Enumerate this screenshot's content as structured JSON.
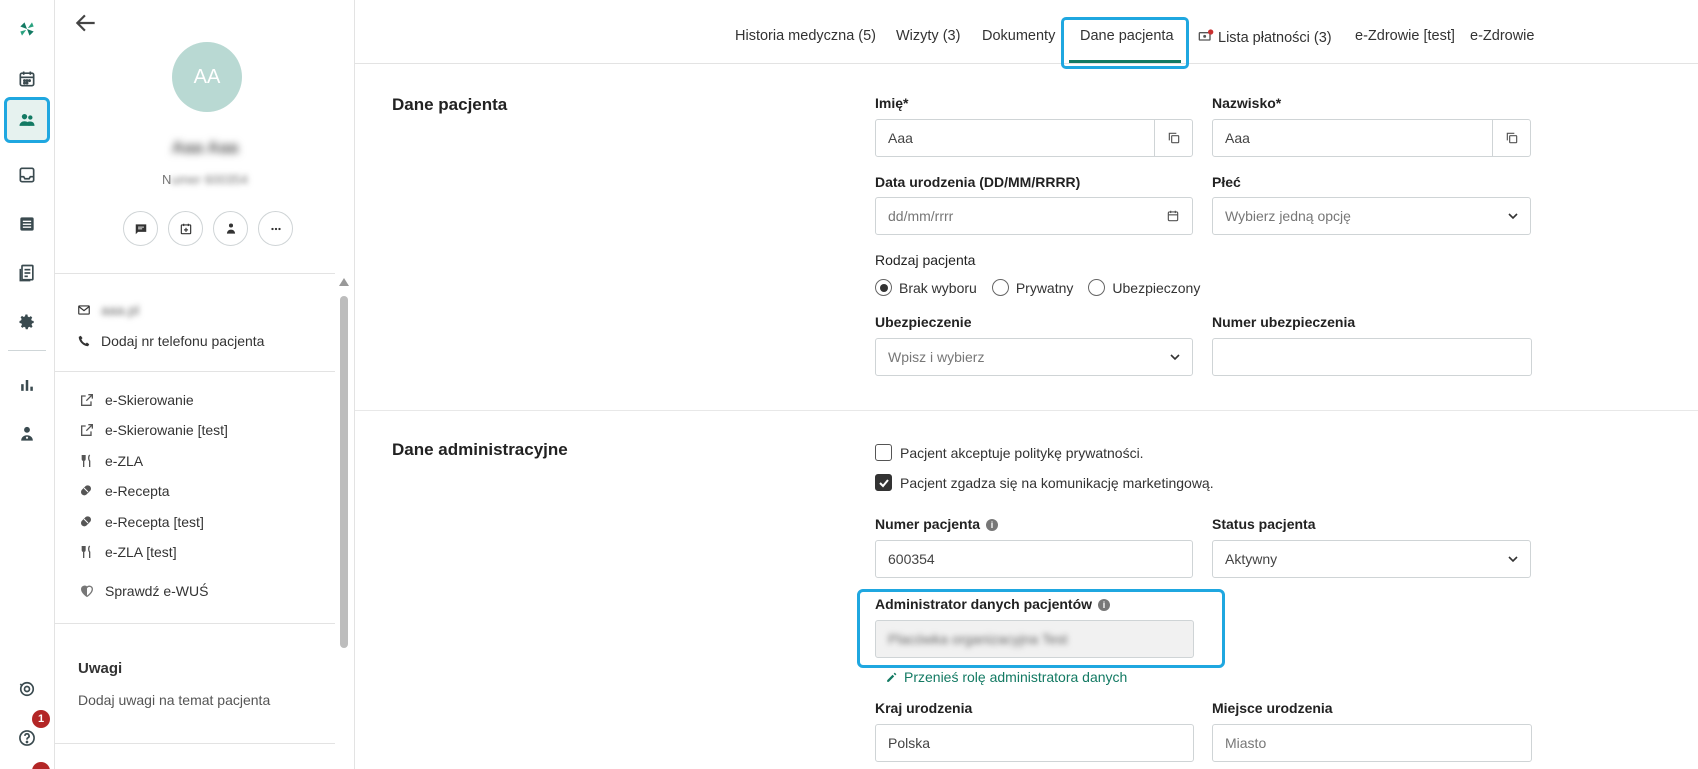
{
  "rail": {
    "badge_help": "1"
  },
  "patient": {
    "initials": "AA",
    "name": "Aaa Aaa",
    "number_prefix": "N",
    "number_rest": "umer 600354",
    "email": "aaa.pl",
    "add_phone": "Dodaj nr telefonu pacjenta",
    "links": [
      {
        "label": "e-Skierowanie",
        "icon": "external-link-icon"
      },
      {
        "label": "e-Skierowanie [test]",
        "icon": "external-link-icon"
      },
      {
        "label": "e-ZLA",
        "icon": "fork-knife-icon"
      },
      {
        "label": "e-Recepta",
        "icon": "pill-icon"
      },
      {
        "label": "e-Recepta [test]",
        "icon": "pill-icon"
      },
      {
        "label": "e-ZLA [test]",
        "icon": "fork-knife-icon"
      }
    ],
    "ewus": "Sprawdź e-WUŚ",
    "notes_title": "Uwagi",
    "notes_add": "Dodaj uwagi na temat pacjenta"
  },
  "tabs": [
    {
      "label": "Historia medyczna (5)"
    },
    {
      "label": "Wizyty (3)"
    },
    {
      "label": "Dokumenty"
    },
    {
      "label": "Dane pacjenta",
      "active": true
    },
    {
      "label": "Lista płatności (3)"
    },
    {
      "label": "e-Zdrowie [test]"
    },
    {
      "label": "e-Zdrowie"
    }
  ],
  "patient_data": {
    "section_title": "Dane pacjenta",
    "first_name_label": "Imię*",
    "first_name_value": "Aaa",
    "last_name_label": "Nazwisko*",
    "last_name_value": "Aaa",
    "dob_label": "Data urodzenia (DD/MM/RRRR)",
    "dob_placeholder": "dd/mm/rrrr",
    "sex_label": "Płeć",
    "sex_placeholder": "Wybierz jedną opcję",
    "type_label": "Rodzaj pacjenta",
    "type_options": [
      "Brak wyboru",
      "Prywatny",
      "Ubezpieczony"
    ],
    "type_selected": "Brak wyboru",
    "insurance_label": "Ubezpieczenie",
    "insurance_placeholder": "Wpisz i wybierz",
    "insurance_number_label": "Numer ubezpieczenia",
    "insurance_number_value": ""
  },
  "admin_data": {
    "section_title": "Dane administracyjne",
    "privacy_consent": "Pacjent akceptuje politykę prywatności.",
    "privacy_checked": false,
    "marketing_consent": "Pacjent zgadza się na komunikację marketingową.",
    "marketing_checked": true,
    "patient_number_label": "Numer pacjenta",
    "patient_number_value": "600354",
    "status_label": "Status pacjenta",
    "status_value": "Aktywny",
    "data_admin_label": "Administrator danych pacjentów",
    "data_admin_value": "Placówka organizacyjna Test",
    "move_role": "Przenieś rolę administratora danych",
    "birth_country_label": "Kraj urodzenia",
    "birth_country_value": "Polska",
    "birth_place_label": "Miejsce urodzenia",
    "birth_place_placeholder": "Miasto"
  }
}
